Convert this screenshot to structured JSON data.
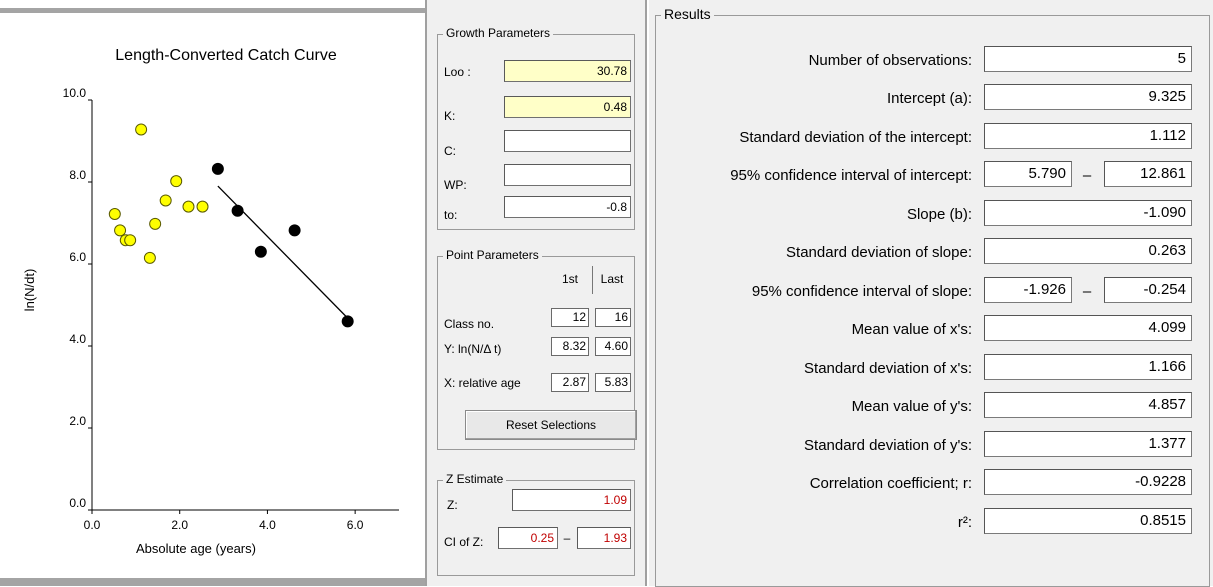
{
  "chart": {
    "title": "Length-Converted Catch Curve",
    "xlabel": "Absolute age (years)",
    "ylabel": "ln(N/dt)"
  },
  "chart_data": {
    "type": "scatter",
    "title": "Length-Converted Catch Curve",
    "xlabel": "Absolute age (years)",
    "ylabel": "ln(N/dt)",
    "xlim": [
      0,
      7
    ],
    "ylim": [
      0,
      10
    ],
    "x_ticks": [
      "0.0",
      "2.0",
      "4.0",
      "6.0"
    ],
    "y_ticks": [
      "0.0",
      "2.0",
      "4.0",
      "6.0",
      "8.0",
      "10.0"
    ],
    "series": [
      {
        "label": "unselected",
        "color": "#ffff00",
        "x": [
          0.52,
          0.64,
          0.77,
          0.87,
          1.12,
          1.32,
          1.44,
          1.68,
          1.92,
          2.2,
          2.52
        ],
        "y": [
          7.22,
          6.82,
          6.58,
          6.58,
          9.28,
          6.15,
          6.98,
          7.55,
          8.02,
          7.4,
          7.4
        ]
      },
      {
        "label": "selected",
        "color": "#000000",
        "x": [
          2.87,
          3.32,
          3.85,
          4.62,
          5.83
        ],
        "y": [
          8.32,
          7.3,
          6.3,
          6.82,
          4.6
        ]
      }
    ],
    "regression_line": {
      "x": [
        2.87,
        5.83
      ],
      "y": [
        7.9,
        4.68
      ]
    },
    "grid": false
  },
  "growth": {
    "title": "Growth Parameters",
    "loo_label": "Loo :",
    "loo_value": "30.78",
    "k_label": "K:",
    "k_value": "0.48",
    "c_label": "C:",
    "c_value": "",
    "wp_label": "WP:",
    "wp_value": "",
    "to_label": "to:",
    "to_value": "-0.8",
    "highlight_color": "#ffffc8"
  },
  "points": {
    "title": "Point Parameters",
    "col_first": "1st",
    "col_last": "Last",
    "rows": [
      {
        "label": "Class no.",
        "first": "12",
        "last": "16"
      },
      {
        "label": "Y: ln(N/Δ t)",
        "first": "8.32",
        "last": "4.60"
      },
      {
        "label": "X: relative age",
        "first": "2.87",
        "last": "5.83"
      }
    ],
    "reset_label": "Reset Selections"
  },
  "zest": {
    "title": "Z Estimate",
    "z_label": "Z:",
    "z_value": "1.09",
    "ci_label": "CI of Z:",
    "ci_low": "0.25",
    "ci_dash": "–",
    "ci_high": "1.93",
    "value_color": "#c00000"
  },
  "results": {
    "title": "Results",
    "rows": [
      {
        "label": "Number of observations:",
        "value": "5"
      },
      {
        "label": "Intercept (a):",
        "value": "9.325"
      },
      {
        "label": "Standard deviation of the intercept:",
        "value": "1.112"
      },
      {
        "label": "95% confidence interval of intercept:",
        "low": "5.790",
        "dash": "–",
        "high": "12.861"
      },
      {
        "label": "Slope (b):",
        "value": "-1.090"
      },
      {
        "label": "Standard deviation of slope:",
        "value": "0.263"
      },
      {
        "label": "95% confidence interval of slope:",
        "low": "-1.926",
        "dash": "–",
        "high": "-0.254"
      },
      {
        "label": "Mean value of x's:",
        "value": "4.099"
      },
      {
        "label": "Standard deviation of x's:",
        "value": "1.166"
      },
      {
        "label": "Mean value of y's:",
        "value": "4.857"
      },
      {
        "label": "Standard deviation of y's:",
        "value": "1.377"
      },
      {
        "label": "Correlation coefficient; r:",
        "value": "-0.9228"
      },
      {
        "label": "r²:",
        "value": "0.8515"
      }
    ]
  }
}
